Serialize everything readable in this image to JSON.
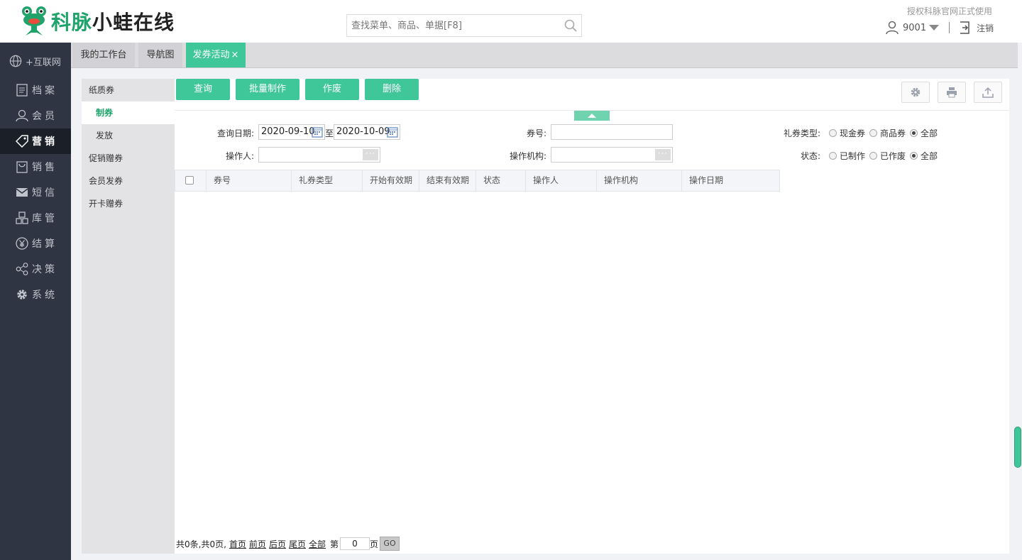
{
  "header": {
    "brand_green": "科脉",
    "brand_dark": "小蛙在线",
    "search_placeholder": "查找菜单、商品、单据[F8]",
    "auth_text": "授权科脉官网正式使用",
    "user": "9001",
    "logout": "注销"
  },
  "leftnav": {
    "items": [
      {
        "label": "+互联网",
        "icon": "globe-icon"
      },
      {
        "label": "档案",
        "icon": "document-icon"
      },
      {
        "label": "会员",
        "icon": "user-icon"
      },
      {
        "label": "营销",
        "icon": "tag-icon"
      },
      {
        "label": "销售",
        "icon": "bag-icon"
      },
      {
        "label": "短信",
        "icon": "mail-icon"
      },
      {
        "label": "库管",
        "icon": "boxes-icon"
      },
      {
        "label": "结算",
        "icon": "yen-icon"
      },
      {
        "label": "决策",
        "icon": "share-icon"
      },
      {
        "label": "系统",
        "icon": "gear-icon"
      }
    ],
    "active": "营销"
  },
  "tabs": [
    {
      "label": "我的工作台"
    },
    {
      "label": "导航图"
    },
    {
      "label": "发券活动",
      "close": "×"
    }
  ],
  "submenu": [
    {
      "label": "纸质券"
    },
    {
      "label": "制券"
    },
    {
      "label": "发放"
    },
    {
      "label": "促销赠券"
    },
    {
      "label": "会员发券"
    },
    {
      "label": "开卡赠券"
    }
  ],
  "toolbar": {
    "query": "查询",
    "batch": "批量制作",
    "void": "作废",
    "delete": "删除"
  },
  "filters": {
    "date_label": "查询日期:",
    "date_from": "2020-09-10",
    "to": "至",
    "date_to": "2020-10-09",
    "coupon_no_label": "券号:",
    "coupon_type_label": "礼券类型:",
    "coupon_type_options": [
      "现金券",
      "商品券",
      "全部"
    ],
    "operator_label": "操作人:",
    "org_label": "操作机构:",
    "status_label": "状态:",
    "status_options": [
      "已制作",
      "已作废",
      "全部"
    ],
    "dots": "···"
  },
  "table": {
    "columns": [
      "券号",
      "礼券类型",
      "开始有效期",
      "结束有效期",
      "状态",
      "操作人",
      "操作机构",
      "操作日期"
    ]
  },
  "pager": {
    "summary": "共0条,共0页,",
    "first": "首页",
    "prev": "前页",
    "next": "后页",
    "last": "尾页",
    "all": "全部",
    "page_prefix": "第",
    "page_value": "0",
    "page_suffix": "页",
    "go": "GO"
  },
  "colors": {
    "accent": "#3fc79a",
    "brand_green": "#20a36a",
    "nav_bg": "#2f3542"
  }
}
